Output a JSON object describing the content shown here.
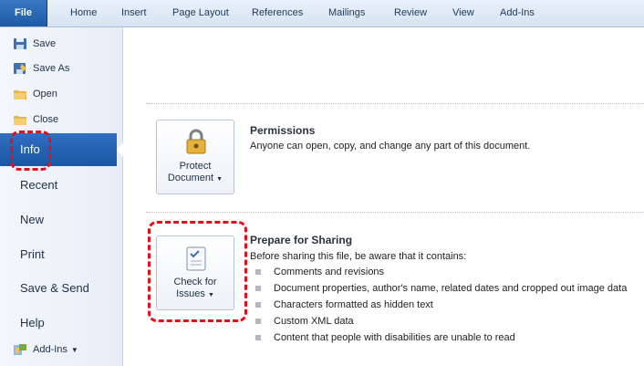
{
  "ribbon": {
    "tabs": [
      "File",
      "Home",
      "Insert",
      "Page Layout",
      "References",
      "Mailings",
      "Review",
      "View",
      "Add-Ins"
    ]
  },
  "backstage": {
    "commands": [
      {
        "label": "Save",
        "icon": "save-icon"
      },
      {
        "label": "Save As",
        "icon": "save-as-icon"
      },
      {
        "label": "Open",
        "icon": "open-folder-icon"
      },
      {
        "label": "Close",
        "icon": "close-folder-icon"
      }
    ],
    "nav": [
      "Info",
      "Recent",
      "New",
      "Print",
      "Save & Send",
      "Help"
    ],
    "active_nav": "Info",
    "addins_label": "Add-Ins"
  },
  "permissions": {
    "button_label_1": "Protect",
    "button_label_2": "Document",
    "title": "Permissions",
    "description": "Anyone can open, copy, and change any part of this document."
  },
  "prepare": {
    "button_label_1": "Check for",
    "button_label_2": "Issues",
    "title": "Prepare for Sharing",
    "description": "Before sharing this file, be aware that it contains:",
    "items": [
      "Comments and revisions",
      "Document properties, author's name, related dates and cropped out image data",
      "Characters formatted as hidden text",
      "Custom XML data",
      "Content that people with disabilities are unable to read"
    ]
  },
  "colors": {
    "accent": "#1e5aa6",
    "highlight": "#e0101c"
  }
}
